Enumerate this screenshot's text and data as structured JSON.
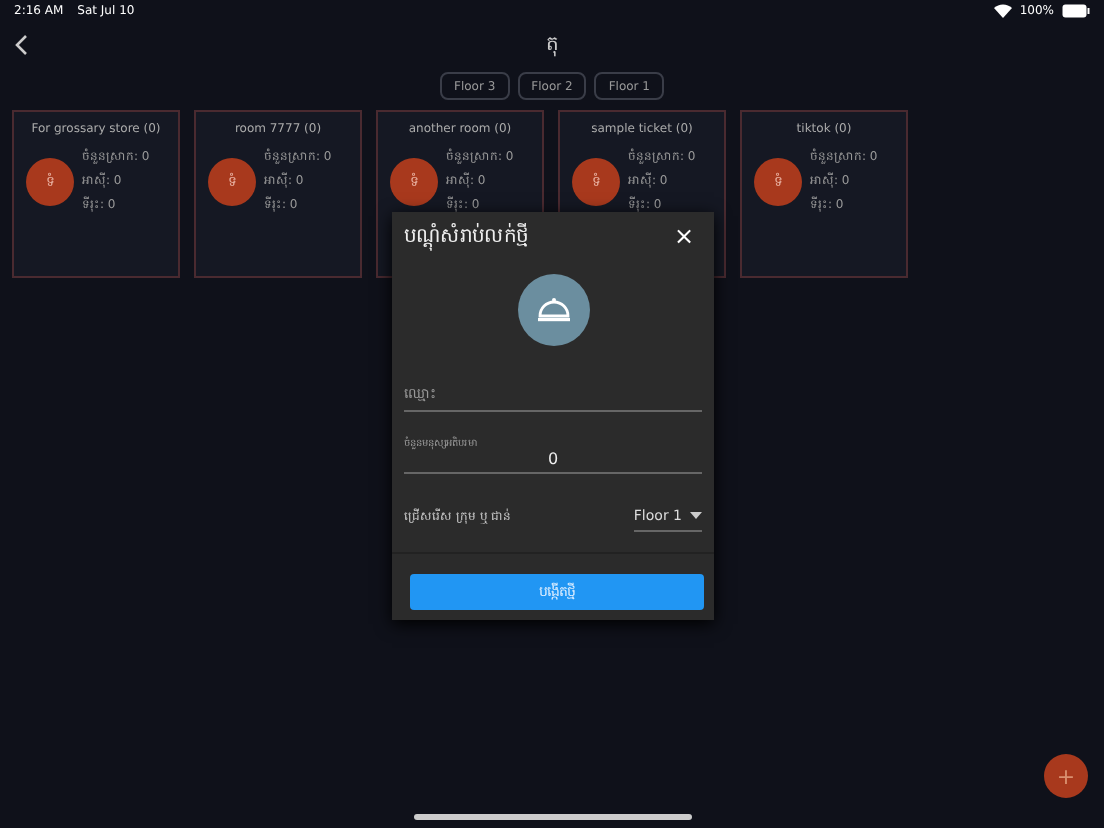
{
  "status_bar": {
    "time": "2:16 AM",
    "date": "Sat Jul 10",
    "battery": "100%"
  },
  "header": {
    "title": "តុ"
  },
  "floors": [
    {
      "label": "Floor 3"
    },
    {
      "label": "Floor 2"
    },
    {
      "label": "Floor 1"
    }
  ],
  "tables": [
    {
      "name": "For grossary store (0)",
      "avatar": "ទំ",
      "lines": [
        "ចំនួនស្រាក: 0",
        "អាសុី: 0",
        "ទីរុះ: 0"
      ]
    },
    {
      "name": "room 7777 (0)",
      "avatar": "ទំ",
      "lines": [
        "ចំនួនស្រាក: 0",
        "អាសុី: 0",
        "ទីរុះ: 0"
      ]
    },
    {
      "name": "another room (0)",
      "avatar": "ទំ",
      "lines": [
        "ចំនួនស្រាក: 0",
        "អាសុី: 0",
        "ទីរុះ: 0"
      ]
    },
    {
      "name": "sample ticket (0)",
      "avatar": "ទំ",
      "lines": [
        "ចំនួនស្រាក: 0",
        "អាសុី: 0",
        "ទីរុះ: 0"
      ]
    },
    {
      "name": "tiktok (0)",
      "avatar": "ទំ",
      "lines": [
        "ចំនួនស្រាក: 0",
        "អាសុី: 0",
        "ទីរុះ: 0"
      ]
    }
  ],
  "dialog": {
    "title": "បណ្តុំសំរាប់លក់ថ្មី",
    "close": "×",
    "name_field": {
      "placeholder": "ឈ្មោះ"
    },
    "capacity_field": {
      "label": "ចំនួនមនុស្សអតិបរមា",
      "value": "0"
    },
    "floor_select": {
      "label": "ជ្រើសរើស ក្រុម ឬ ជាន់",
      "value": "Floor 1"
    },
    "submit": "បង្កើតថ្មី"
  },
  "fab": {
    "label": "+"
  }
}
